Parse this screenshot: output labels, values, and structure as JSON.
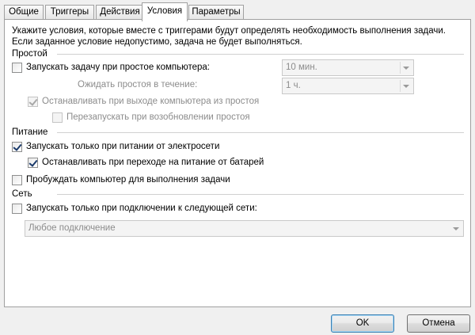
{
  "tabs": [
    {
      "label": "Общие",
      "active": false
    },
    {
      "label": "Триггеры",
      "active": false
    },
    {
      "label": "Действия",
      "active": false
    },
    {
      "label": "Условия",
      "active": true
    },
    {
      "label": "Параметры",
      "active": false
    }
  ],
  "description": "Укажите условия, которые вместе с триггерами будут определять необходимость выполнения задачи. Если заданное условие недопустимо, задача не будет выполняться.",
  "idle": {
    "title": "Простой",
    "start_on_idle": {
      "label": "Запускать задачу при простое компьютера:",
      "checked": false
    },
    "idle_duration_value": "10 мин.",
    "wait_label": "Ожидать простоя в течение:",
    "wait_value": "1 ч.",
    "stop_on_resume": {
      "label": "Останавливать при выходе компьютера из простоя",
      "checked": true,
      "disabled": true
    },
    "restart_on_idle": {
      "label": "Перезапускать при возобновлении простоя",
      "checked": false,
      "disabled": true
    }
  },
  "power": {
    "title": "Питание",
    "ac_only": {
      "label": "Запускать только при питании от электросети",
      "checked": true
    },
    "stop_on_battery": {
      "label": "Останавливать при переходе на питание от батарей",
      "checked": true
    },
    "wake": {
      "label": "Пробуждать компьютер для выполнения задачи",
      "checked": false
    }
  },
  "network": {
    "title": "Сеть",
    "network_only": {
      "label": "Запускать только при подключении к следующей сети:",
      "checked": false
    },
    "network_value": "Любое подключение"
  },
  "buttons": {
    "ok": "OK",
    "cancel": "Отмена"
  }
}
